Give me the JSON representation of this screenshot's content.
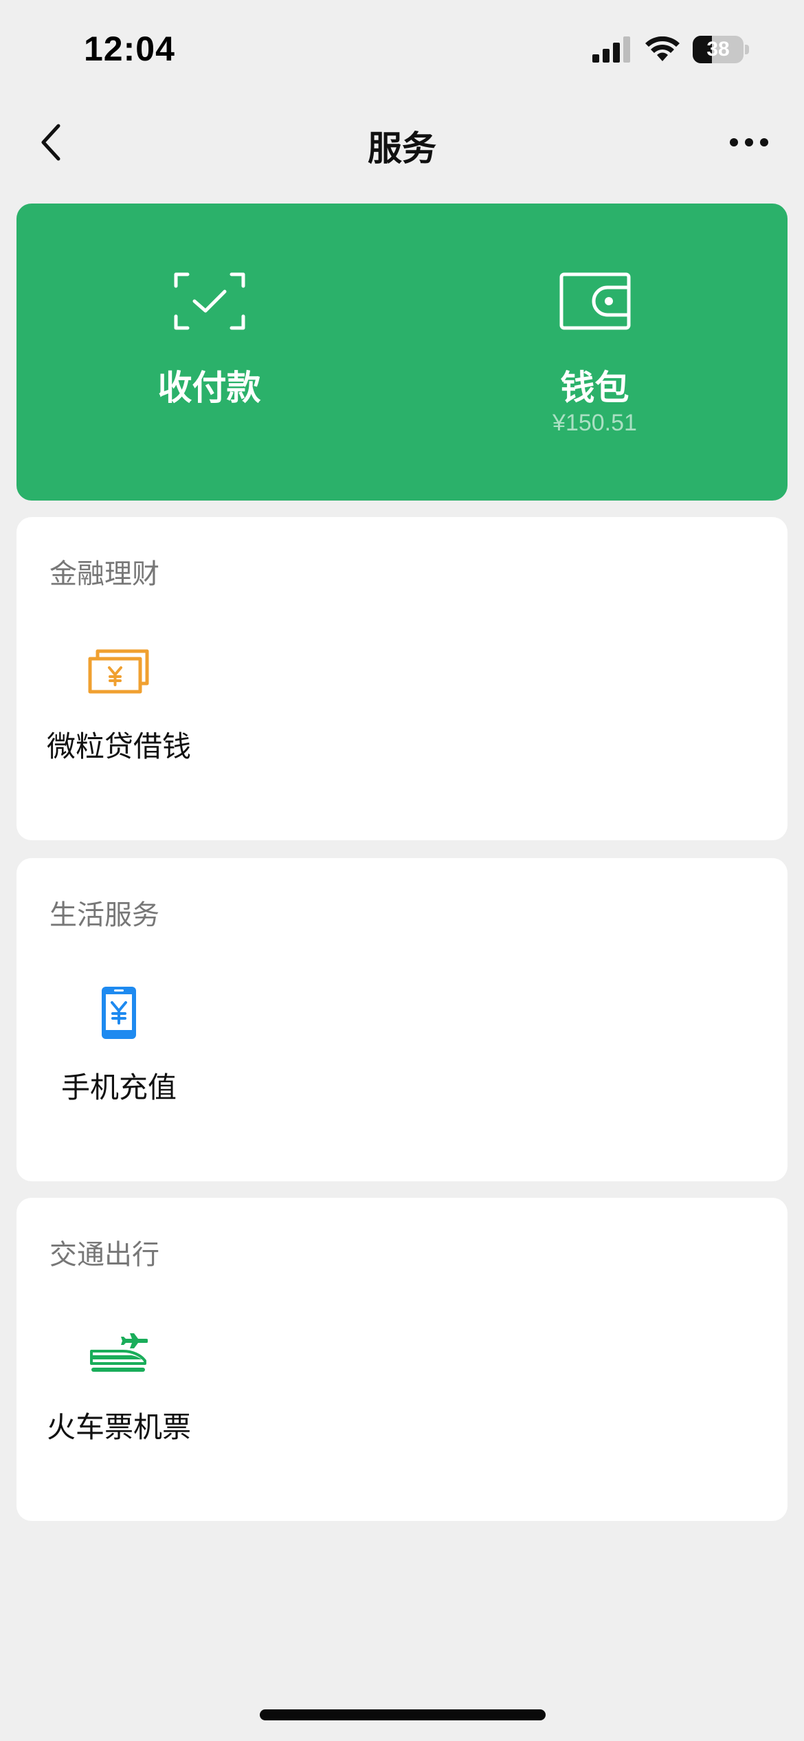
{
  "status_bar": {
    "time": "12:04",
    "battery_level": "38",
    "battery_fraction": 0.38
  },
  "nav": {
    "title": "服务"
  },
  "banner": {
    "pay": {
      "label": "收付款",
      "icon": "scan-check-icon"
    },
    "wallet": {
      "label": "钱包",
      "balance": "¥150.51",
      "icon": "wallet-icon"
    }
  },
  "sections": [
    {
      "title": "金融理财",
      "items": [
        {
          "label": "微粒贷借钱",
          "icon": "yuan-bills-icon",
          "color": "#F0A030"
        }
      ]
    },
    {
      "title": "生活服务",
      "items": [
        {
          "label": "手机充值",
          "icon": "phone-recharge-icon",
          "color": "#1E8AF0"
        }
      ]
    },
    {
      "title": "交通出行",
      "items": [
        {
          "label": "火车票机票",
          "icon": "train-plane-icon",
          "color": "#1AAD5A"
        }
      ]
    }
  ],
  "colors": {
    "banner_green": "#2BB16A",
    "background": "#EFEFEF"
  }
}
